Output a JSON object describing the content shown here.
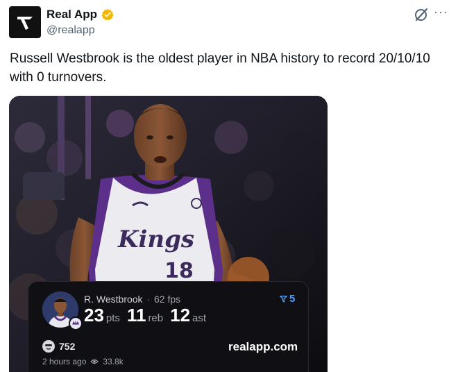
{
  "account": {
    "display_name": "Real App",
    "handle": "@realapp",
    "verified": true,
    "verified_color": "#f5b700"
  },
  "actions": {
    "grok_icon": "grok-icon",
    "more_label": "···"
  },
  "tweet": {
    "text": "Russell Westbrook is the oldest player in NBA history to record 20/10/10 with 0 turnovers."
  },
  "card": {
    "player_name": "R. Westbrook",
    "fps": "62 fps",
    "separator": "·",
    "stats": [
      {
        "value": "23",
        "unit": "pts"
      },
      {
        "value": "11",
        "unit": "reb"
      },
      {
        "value": "12",
        "unit": "ast"
      }
    ],
    "votes": "5",
    "reactions": "752",
    "site": "realapp.com",
    "time_ago": "2 hours ago",
    "views": "33.8k",
    "jersey_text": "Kings",
    "jersey_number": "18"
  },
  "colors": {
    "text_primary": "#0f1419",
    "text_secondary": "#536471",
    "card_bg": "#101014",
    "accent_blue": "#4aa3ff"
  }
}
